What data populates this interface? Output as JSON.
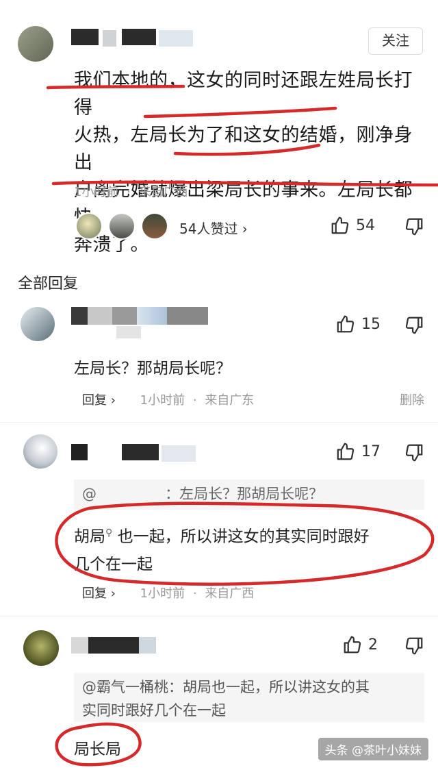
{
  "post": {
    "follow_label": "关注",
    "lines": [
      "我们本地的，这女的同时还跟左姓局长打得",
      "火热，左局长为了和这女的结婚，刚净身出",
      "户离完婚就爆出梁局长的事来。左局长都快",
      "奔溃了。"
    ],
    "time": "1小时前",
    "dot": "·",
    "location": "来自广西",
    "likers_label": "54人赞过 ›",
    "like_count": "54"
  },
  "section_title": "全部回复",
  "replies": [
    {
      "like_count": "15",
      "text": "左局长？那胡局长呢？",
      "reply_label": "回复 ›",
      "time": "1小时前",
      "location": "来自广东",
      "delete_label": "删除"
    },
    {
      "like_count": "17",
      "quote": "@               ：左局长？那胡局长呢？",
      "text_line1": "胡局",
      "text_rest1": " 也一起，所以讲这女的其实同时跟好",
      "text_line2": "几个在一起",
      "reply_label": "回复 ›",
      "time": "1小时前",
      "location": "来自广西"
    },
    {
      "like_count": "2",
      "quote_line1": "@霸气一桶桃：胡局也一起，所以讲这女的其",
      "quote_line2": "实同时跟好几个在一起",
      "text": "局长局"
    }
  ],
  "watermark": "头条 @茶叶小妹妹",
  "colors": {
    "annotation": "#d42a2a",
    "blur_dark": "#2b2b2b",
    "blur_light": "#d8dde2"
  }
}
